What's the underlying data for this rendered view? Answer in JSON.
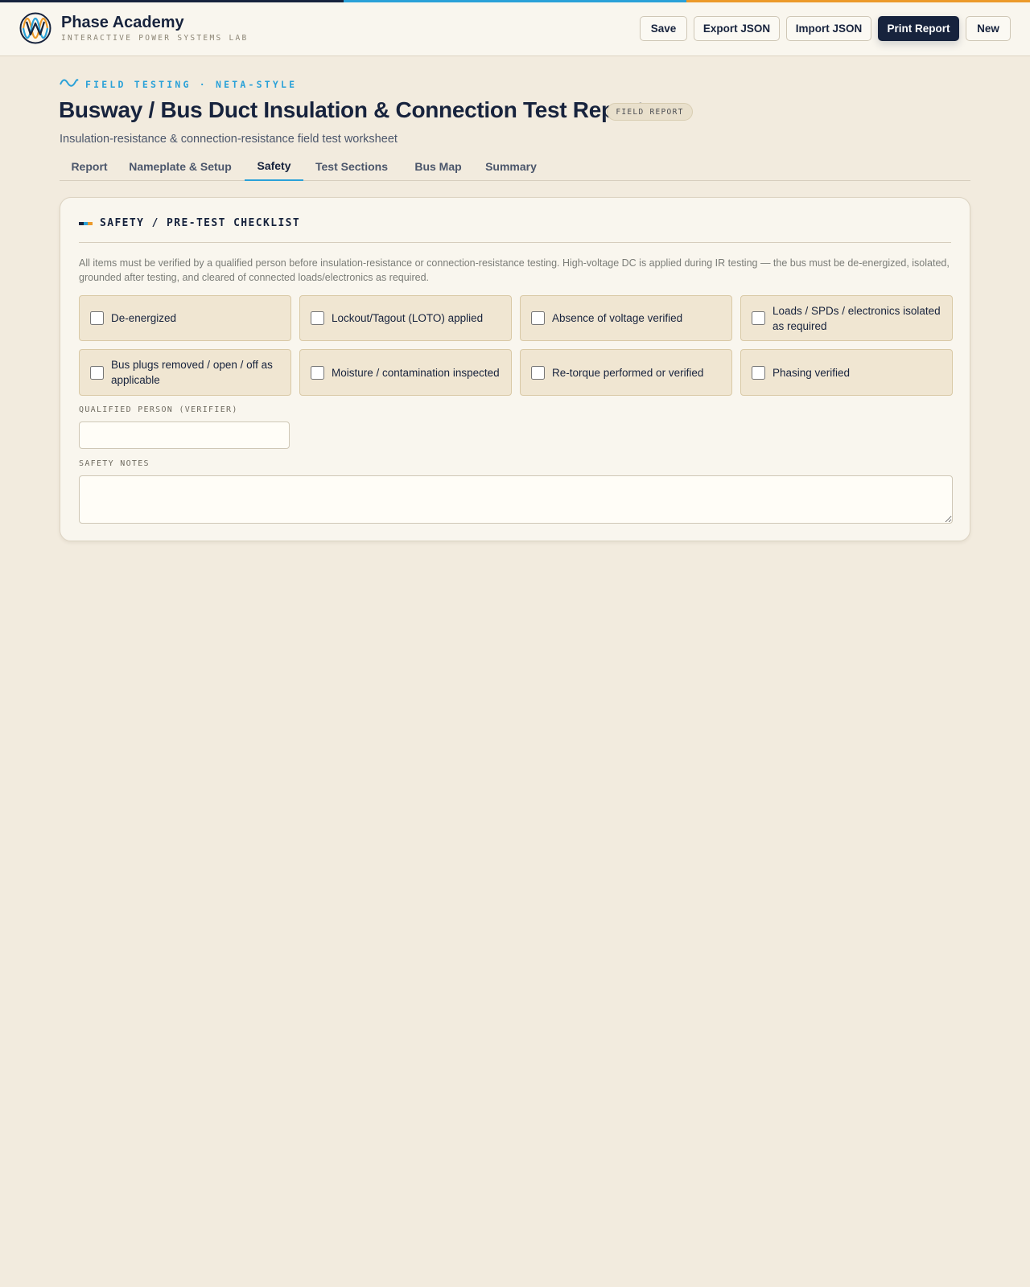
{
  "colors": {
    "navy": "#17233d",
    "accent_blue": "#2aa1d8",
    "accent_orange": "#ec9a2a",
    "background": "#f2ebde",
    "card": "#f9f6ee"
  },
  "brand": {
    "name": "Phase Academy",
    "subtitle": "INTERACTIVE POWER SYSTEMS LAB",
    "logo_icon": "sine-wave-logo-icon"
  },
  "header_buttons": {
    "save": "Save",
    "export": "Export JSON",
    "import": "Import JSON",
    "print": "Print Report",
    "new": "New"
  },
  "page": {
    "eyebrow": "FIELD TESTING · NETA-STYLE",
    "eyebrow_icon": "wave-icon",
    "title": "Busway / Bus Duct Insulation & Connection Test Report",
    "badge": "FIELD REPORT",
    "subtitle": "Insulation-resistance & connection-resistance field test worksheet"
  },
  "tabs": [
    {
      "label": "Report",
      "active": false
    },
    {
      "label": "Nameplate & Setup",
      "active": false
    },
    {
      "label": "Safety",
      "active": true
    },
    {
      "label": "Test Sections",
      "active": false
    },
    {
      "label": "Bus Map",
      "active": false
    },
    {
      "label": "Summary",
      "active": false
    }
  ],
  "safety": {
    "title": "SAFETY / PRE-TEST CHECKLIST",
    "description": "All items must be verified by a qualified person before insulation-resistance or connection-resistance testing. High-voltage DC is applied during IR testing — the bus must be de-energized, isolated, grounded after testing, and cleared of connected loads/electronics as required.",
    "checklist": [
      {
        "label": "De-energized",
        "checked": false
      },
      {
        "label": "Lockout/Tagout (LOTO) applied",
        "checked": false
      },
      {
        "label": "Absence of voltage verified",
        "checked": false
      },
      {
        "label": "Loads / SPDs / electronics isolated as required",
        "checked": false
      },
      {
        "label": "Bus plugs removed / open / off as applicable",
        "checked": false
      },
      {
        "label": "Moisture / contamination inspected",
        "checked": false
      },
      {
        "label": "Re-torque performed or verified",
        "checked": false
      },
      {
        "label": "Phasing verified",
        "checked": false
      }
    ],
    "verifier_label": "QUALIFIED PERSON (VERIFIER)",
    "verifier_value": "",
    "notes_label": "SAFETY NOTES",
    "notes_value": ""
  }
}
